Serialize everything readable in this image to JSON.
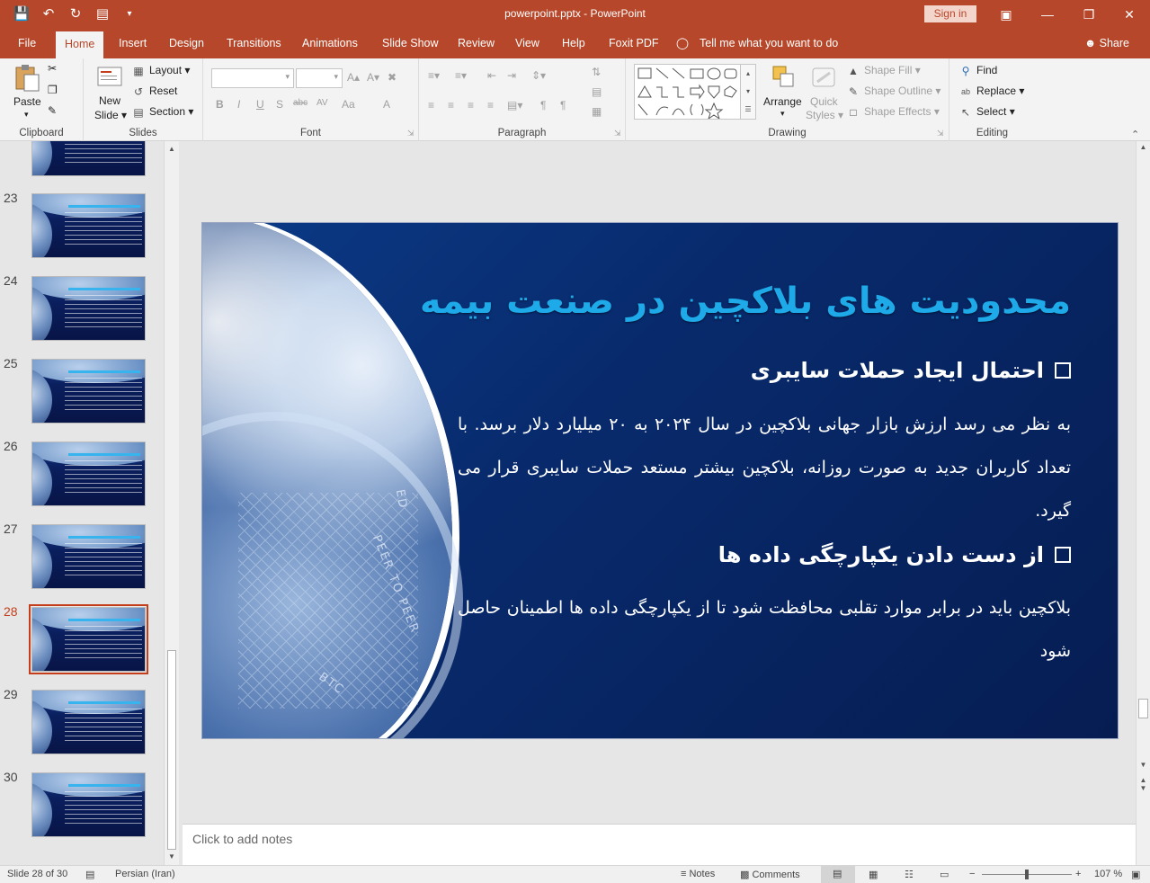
{
  "window": {
    "title": "powerpoint.pptx  -  PowerPoint",
    "sign_in": "Sign in",
    "minimize": "—",
    "restore": "❐",
    "close": "✕",
    "ribbon_display": "▣"
  },
  "tabs": [
    "File",
    "Home",
    "Insert",
    "Design",
    "Transitions",
    "Animations",
    "Slide Show",
    "Review",
    "View",
    "Help",
    "Foxit PDF"
  ],
  "active_tab": "Home",
  "tell_me": "Tell me what you want to do",
  "share": "Share",
  "ribbon": {
    "clipboard": {
      "label": "Clipboard",
      "paste": "Paste"
    },
    "slides": {
      "label": "Slides",
      "new_slide": "New",
      "new_slide_2": "Slide",
      "layout": "Layout",
      "reset": "Reset",
      "section": "Section"
    },
    "font": {
      "label": "Font",
      "bold": "B",
      "italic": "I",
      "underline": "U",
      "shadow": "S",
      "strike": "abc",
      "spacing": "AV",
      "case": "Aa",
      "color": "A"
    },
    "paragraph": {
      "label": "Paragraph"
    },
    "drawing": {
      "label": "Drawing",
      "arrange": "Arrange",
      "quick_styles": "Quick",
      "quick_styles_2": "Styles",
      "shape_fill": "Shape Fill",
      "shape_outline": "Shape Outline",
      "shape_effects": "Shape Effects"
    },
    "editing": {
      "label": "Editing",
      "find": "Find",
      "replace": "Replace",
      "select": "Select"
    }
  },
  "thumbnails": [
    {
      "num": "23"
    },
    {
      "num": "24"
    },
    {
      "num": "25"
    },
    {
      "num": "26"
    },
    {
      "num": "27"
    },
    {
      "num": "28"
    },
    {
      "num": "29"
    },
    {
      "num": "30"
    }
  ],
  "selected_slide": "28",
  "slide": {
    "title": "محدودیت های بلاکچین در صنعت بیمه",
    "bullet1": "احتمال ایجاد حملات سایبری",
    "para1": "به نظر می رسد ارزش بازار جهانی بلاکچین در سال ۲۰۲۴ به ۲۰ میلیارد دلار برسد. با تعداد کاربران جدید به صورت روزانه، بلاکچین بیشتر مستعد حملات سایبری قرار می گیرد.",
    "bullet2": "از دست دادن یکپارچگی داده ها",
    "para2": "بلاکچین باید در برابر موارد تقلبی محافظت شود تا از یکپارچگی داده ها اطمینان حاصل شود",
    "coin_text_1": "PEER TO PEER",
    "coin_text_2": "BTC",
    "coin_text_3": "ED"
  },
  "notes_placeholder": "Click to add notes",
  "status": {
    "slide_info": "Slide 28 of 30",
    "language": "Persian (Iran)",
    "notes": "Notes",
    "comments": "Comments",
    "zoom": "107 %",
    "zoom_minus": "−",
    "zoom_plus": "+"
  },
  "colors": {
    "accent": "#b7472a",
    "slide_title": "#1ea9e8",
    "slide_bg": "#082a6c"
  }
}
